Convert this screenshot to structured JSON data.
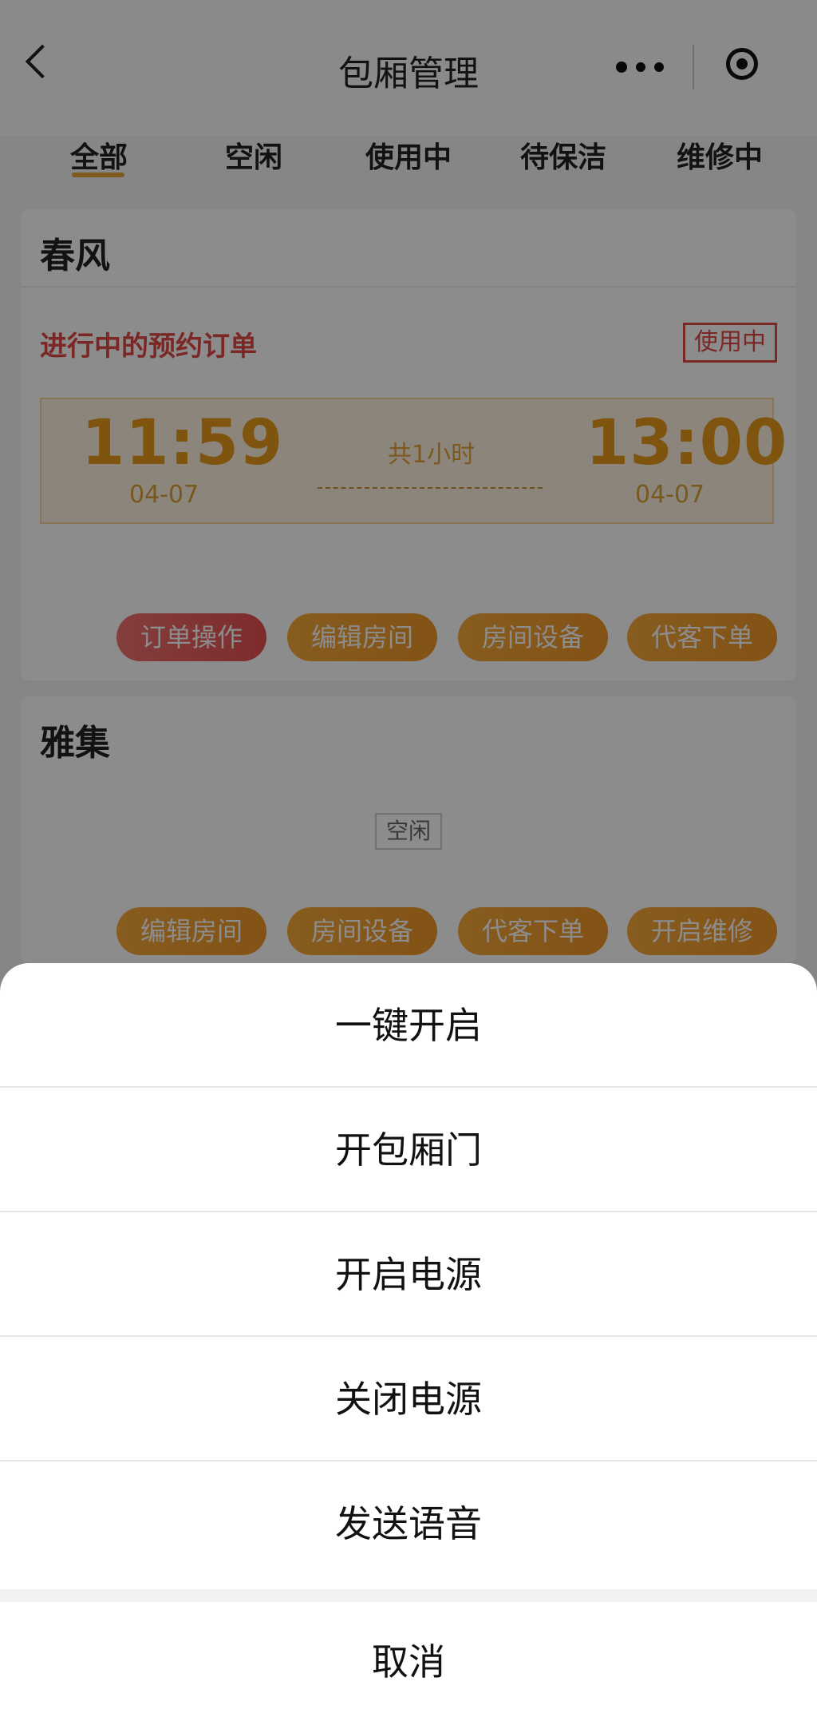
{
  "nav": {
    "title": "包厢管理"
  },
  "tabs": [
    {
      "label": "全部",
      "active": true
    },
    {
      "label": "空闲"
    },
    {
      "label": "使用中"
    },
    {
      "label": "待保洁"
    },
    {
      "label": "维修中"
    }
  ],
  "rooms": [
    {
      "name": "春风",
      "order_label": "进行中的预约订单",
      "status": "使用中",
      "start_time": "11:59",
      "start_date": "04-07",
      "duration": "共1小时",
      "end_time": "13:00",
      "end_date": "04-07",
      "actions": [
        "订单操作",
        "编辑房间",
        "房间设备",
        "代客下单"
      ]
    },
    {
      "name": "雅集",
      "status": "空闲",
      "actions": [
        "编辑房间",
        "房间设备",
        "代客下单",
        "开启维修"
      ]
    }
  ],
  "action_sheet": {
    "items": [
      "一键开启",
      "开包厢门",
      "开启电源",
      "关闭电源",
      "发送语音"
    ],
    "cancel": "取消"
  },
  "colors": {
    "accent_orange": "#ef9627",
    "accent_red": "#e04745",
    "overlay": "rgba(0,0,0,0.45)"
  },
  "icons": [
    "back-chevron-icon",
    "more-dots-icon",
    "target-circle-icon"
  ]
}
